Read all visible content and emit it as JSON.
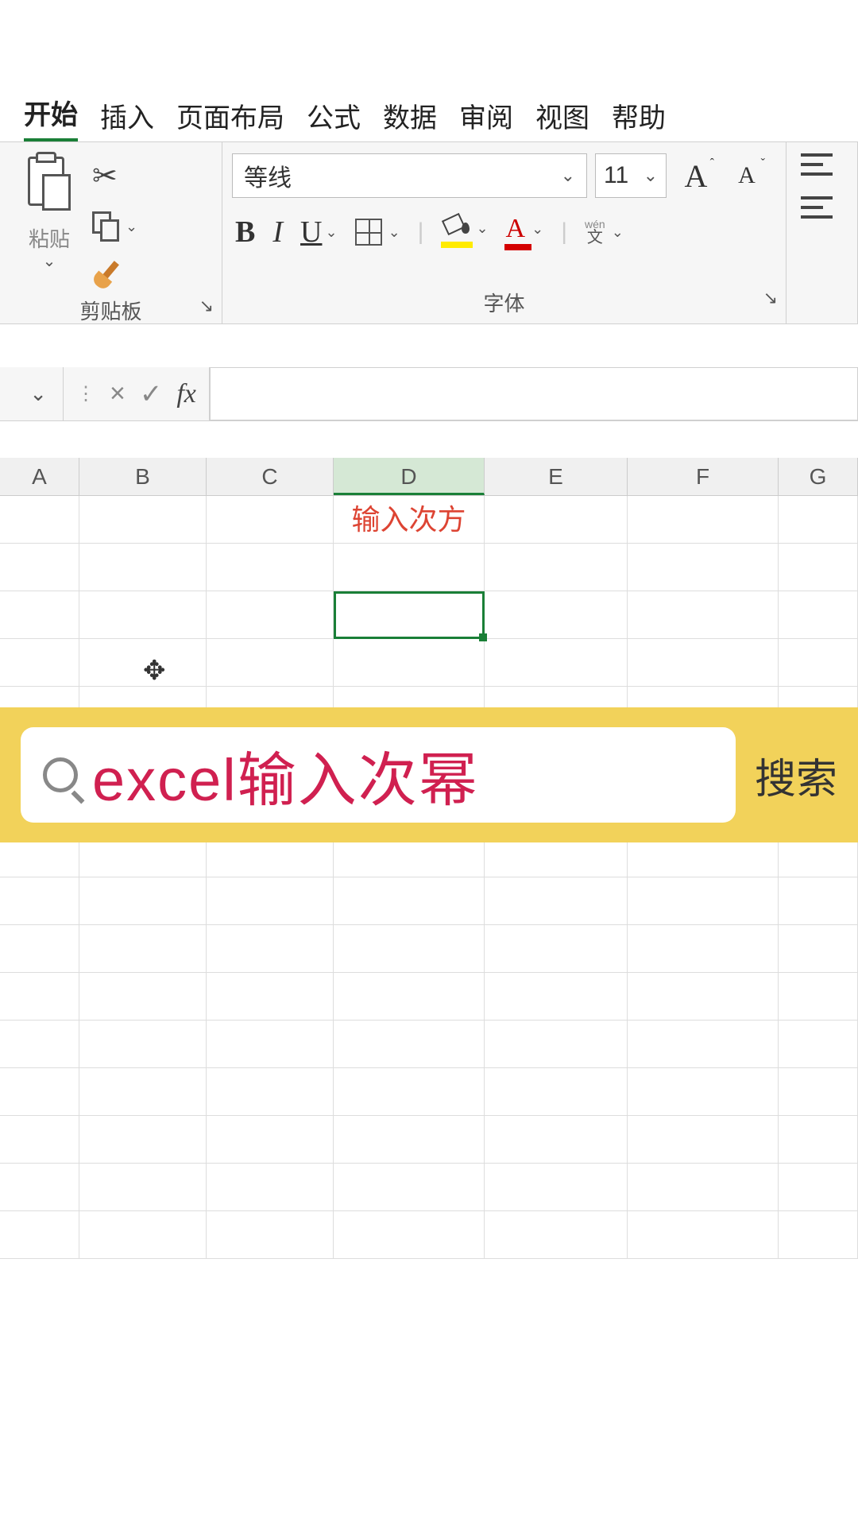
{
  "tabs": {
    "items": [
      "开始",
      "插入",
      "页面布局",
      "公式",
      "数据",
      "审阅",
      "视图",
      "帮助"
    ],
    "active_index": 0
  },
  "ribbon": {
    "clipboard": {
      "group_label": "剪贴板",
      "paste_label": "粘贴"
    },
    "font": {
      "group_label": "字体",
      "font_name": "等线",
      "font_size": "11",
      "bold": "B",
      "italic": "I",
      "underline": "U",
      "wen_pinyin": "wén",
      "wen_char": "文"
    }
  },
  "formula_bar": {
    "fx_label": "fx",
    "value": ""
  },
  "columns": [
    "A",
    "B",
    "C",
    "D",
    "E",
    "F",
    "G"
  ],
  "cells": {
    "D1": "输入次方"
  },
  "selected_cell": "D3",
  "search_overlay": {
    "query": "excel输入次幂",
    "button": "搜索"
  }
}
